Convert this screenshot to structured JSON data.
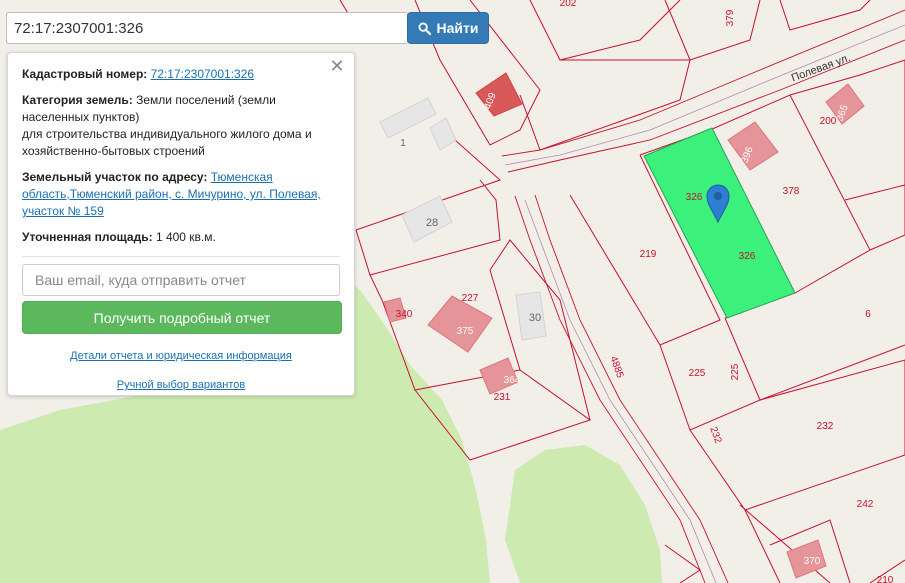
{
  "search": {
    "value": "72:17:2307001:326",
    "button_label": "Найти",
    "button_icon": "search-icon"
  },
  "info": {
    "cadastral_label": "Кадастровый номер:",
    "cadastral_number": "72:17:2307001:326",
    "category_label": "Категория земель:",
    "category_value": "Земли поселений (земли населенных пунктов)",
    "purpose": "для строительства индивидуального жилого дома и хозяйственно-бытовых строений",
    "address_label": "Земельный участок по адресу:",
    "address_value": "Тюменская область,Тюменский район, с. Мичурино, ул. Полевая, участок № 159",
    "area_label": "Уточненная площадь:",
    "area_value": "1 400 кв.м.",
    "email_placeholder": "Ваш email, куда отправить отчет",
    "report_button": "Получить подробный отчет",
    "details_link": "Детали отчета и юридическая информация",
    "manual_link": "Ручной выбор вариантов",
    "close_icon": "close-icon"
  },
  "map": {
    "street": "Полевая ул.",
    "labels": {
      "p202": "202",
      "p379": "379",
      "p409": "409",
      "p1": "1",
      "p200": "200",
      "p365": "365",
      "p396": "396",
      "p326a": "326",
      "p326b": "326",
      "p378": "378",
      "p28": "28",
      "p219": "219",
      "p227": "227",
      "p375": "375",
      "p30": "30",
      "p340": "340",
      "p364": "364",
      "p231": "231",
      "p6": "6",
      "p225a": "225",
      "p225b": "225",
      "p4885": "4885",
      "p232a": "232",
      "p232b": "232",
      "p242": "242",
      "p370": "370",
      "p210": "210"
    },
    "colors": {
      "background": "#f2efe9",
      "parcel_line": "#c8102e",
      "selected_fill": "#3cf07c",
      "green_area": "#cdebb0",
      "building": "#e5949a",
      "marker": "#2e7fd1"
    }
  }
}
